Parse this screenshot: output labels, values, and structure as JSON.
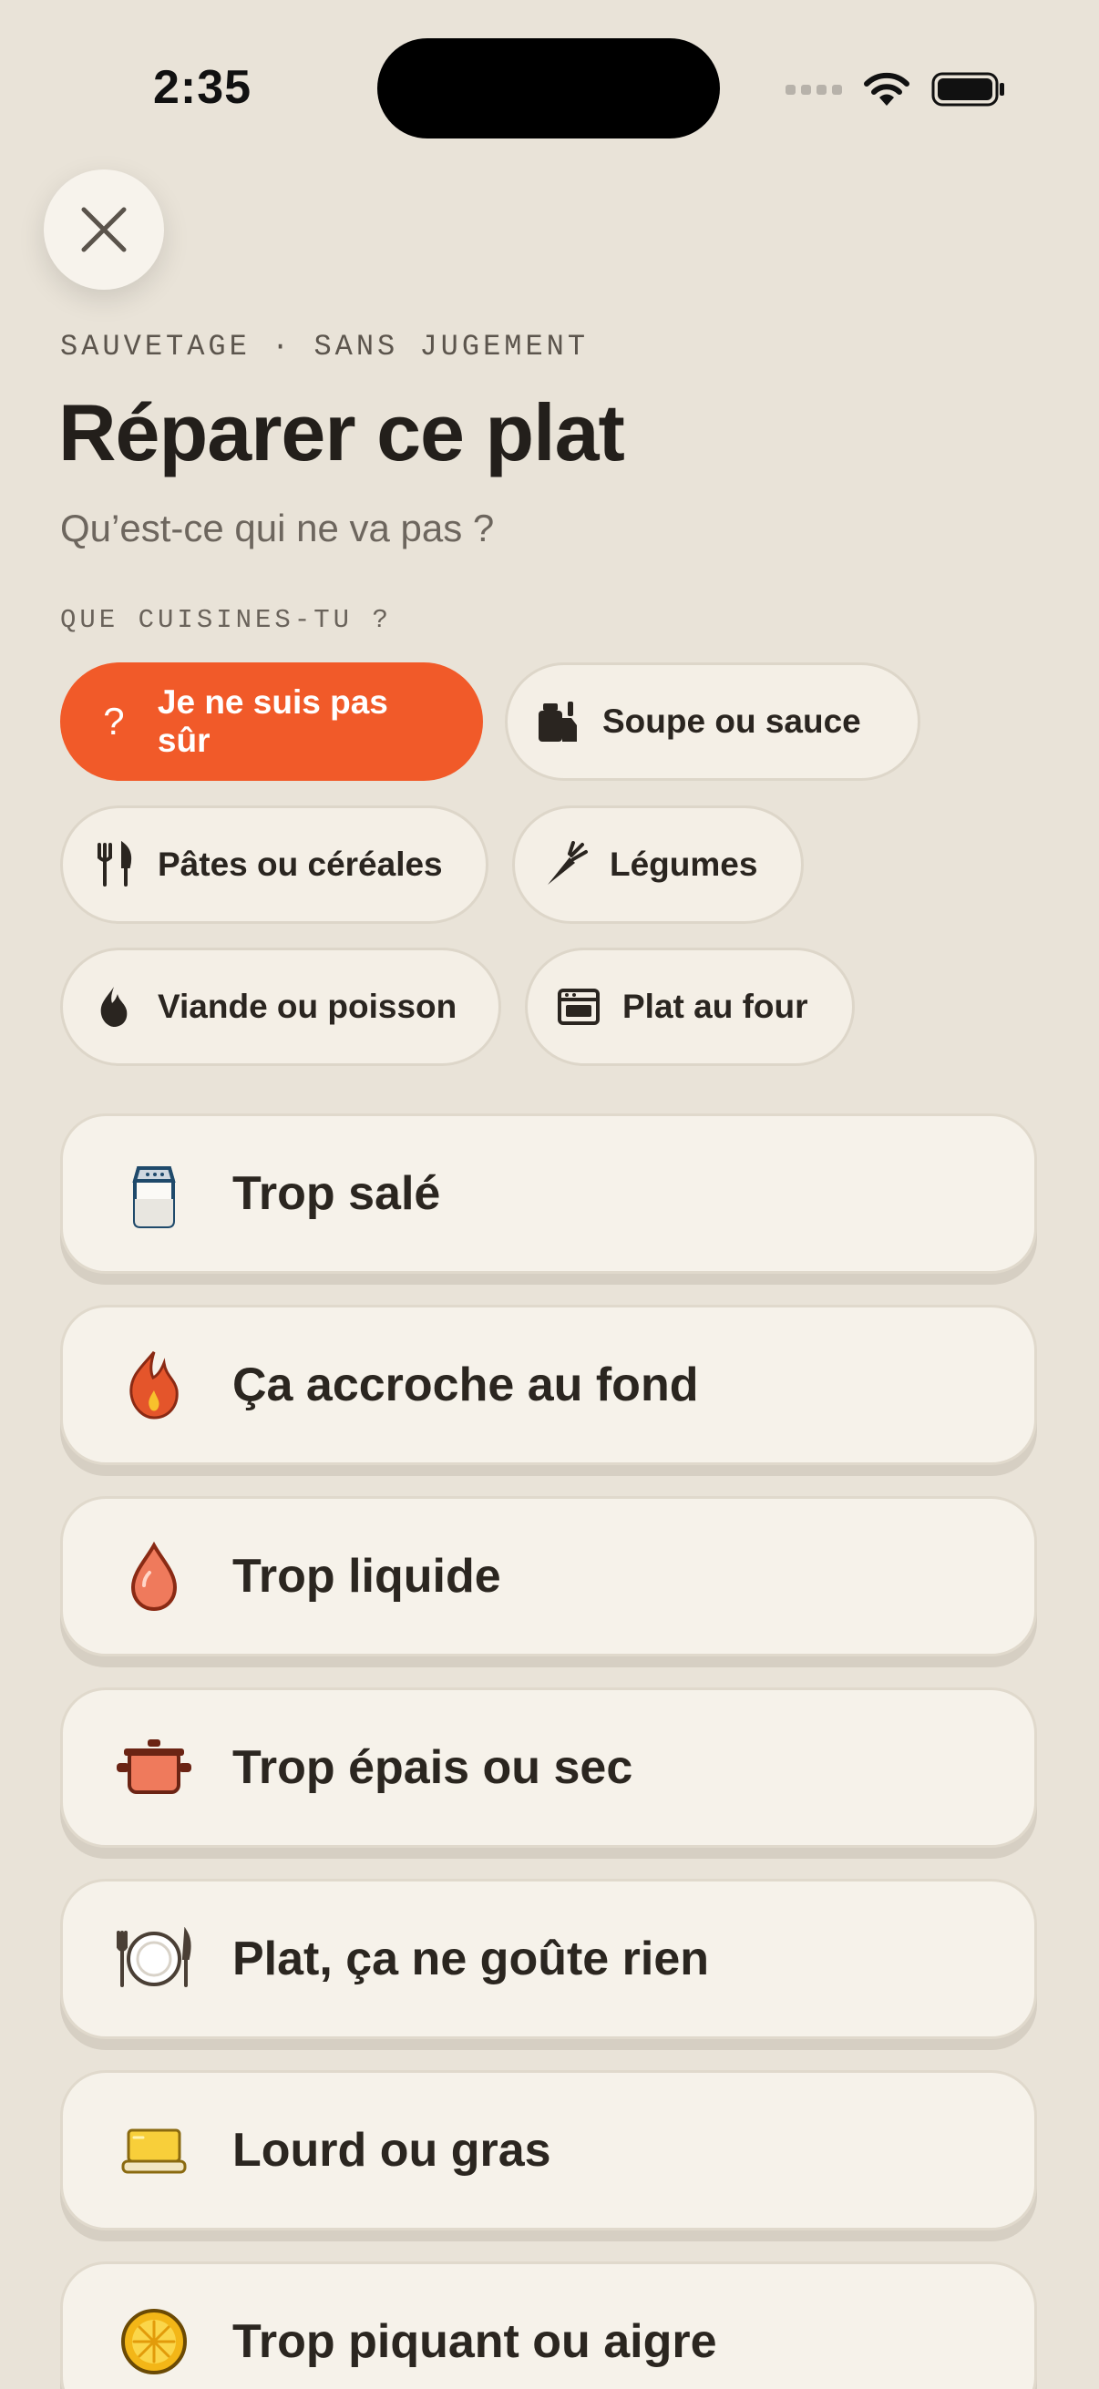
{
  "status_bar": {
    "time": "2:35"
  },
  "header": {
    "eyebrow": "SAUVETAGE · SANS JUGEMENT",
    "title": "Réparer ce plat",
    "subtitle": "Qu’est-ce qui ne va pas ?"
  },
  "cuisine": {
    "label": "QUE CUISINES-TU ?",
    "chips": [
      {
        "label": "Je ne suis pas sûr",
        "icon": "question-icon",
        "selected": true
      },
      {
        "label": "Soupe ou sauce",
        "icon": "pot-icon",
        "selected": false
      },
      {
        "label": "Pâtes ou céréales",
        "icon": "fork-knife-icon",
        "selected": false
      },
      {
        "label": "Légumes",
        "icon": "carrot-icon",
        "selected": false
      },
      {
        "label": "Viande ou poisson",
        "icon": "flame-icon",
        "selected": false
      },
      {
        "label": "Plat au four",
        "icon": "oven-icon",
        "selected": false
      }
    ]
  },
  "problems": [
    {
      "label": "Trop salé",
      "icon": "salt-shaker-icon"
    },
    {
      "label": "Ça accroche au fond",
      "icon": "fire-icon"
    },
    {
      "label": "Trop liquide",
      "icon": "droplet-icon"
    },
    {
      "label": "Trop épais ou sec",
      "icon": "pot-icon"
    },
    {
      "label": "Plat, ça ne goûte rien",
      "icon": "plate-icon"
    },
    {
      "label": "Lourd ou gras",
      "icon": "butter-icon"
    },
    {
      "label": "Trop piquant ou aigre",
      "icon": "citrus-icon"
    }
  ],
  "colors": {
    "accent": "#f15a29",
    "background": "#e9e3d8",
    "card": "#f6f2ea"
  }
}
